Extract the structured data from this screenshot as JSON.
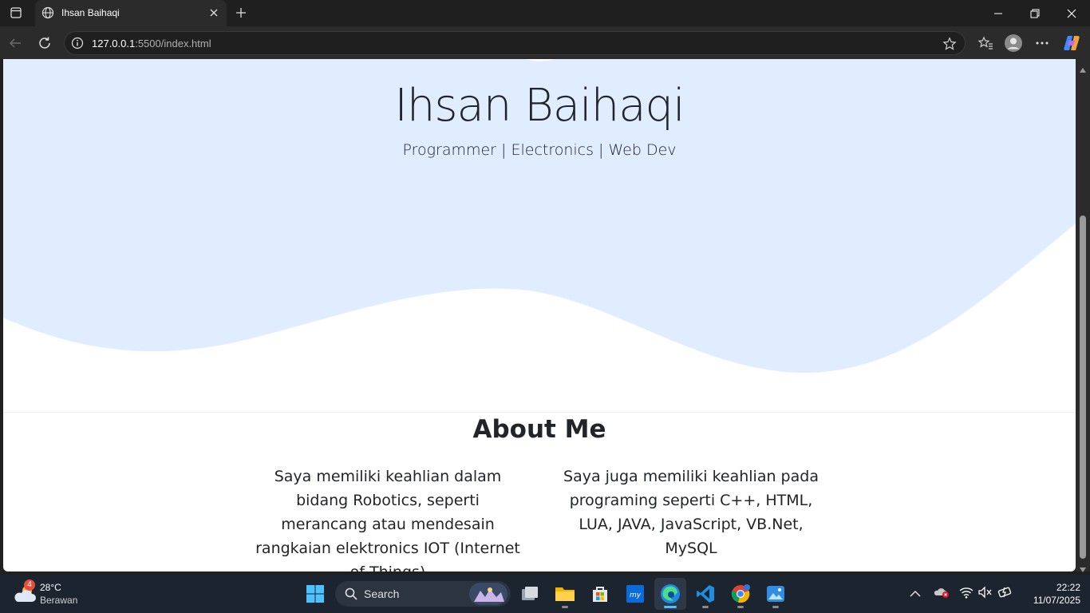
{
  "browser": {
    "tab_title": "Ihsan Baihaqi",
    "url_host": "127.0.0.1",
    "url_rest": ":5500/index.html"
  },
  "page": {
    "name": "Ihsan Baihaqi",
    "tagline": "Programmer | Electronics | Web Dev",
    "about_title": "About Me",
    "about_left": "Saya memiliki keahlian dalam bidang Robotics, seperti merancang atau mendesain rangkaian elektronics IOT (Internet of Things)",
    "about_right": "Saya juga memiliki keahlian pada programing seperti C++, HTML, LUA, JAVA, JavaScript, VB.Net, MySQL",
    "hero_color": "#e0ecff"
  },
  "taskbar": {
    "weather_temp": "28°C",
    "weather_desc": "Berawan",
    "weather_badge": "4",
    "search_label": "Search",
    "time": "22:22",
    "date": "11/07/2025",
    "apps": [
      "task-view",
      "file-explorer",
      "microsoft-store",
      "myhp",
      "edge",
      "vscode",
      "chrome",
      "photos"
    ]
  },
  "colors": {
    "accent": "#4cc2ff",
    "taskbar": "#1c2430"
  }
}
